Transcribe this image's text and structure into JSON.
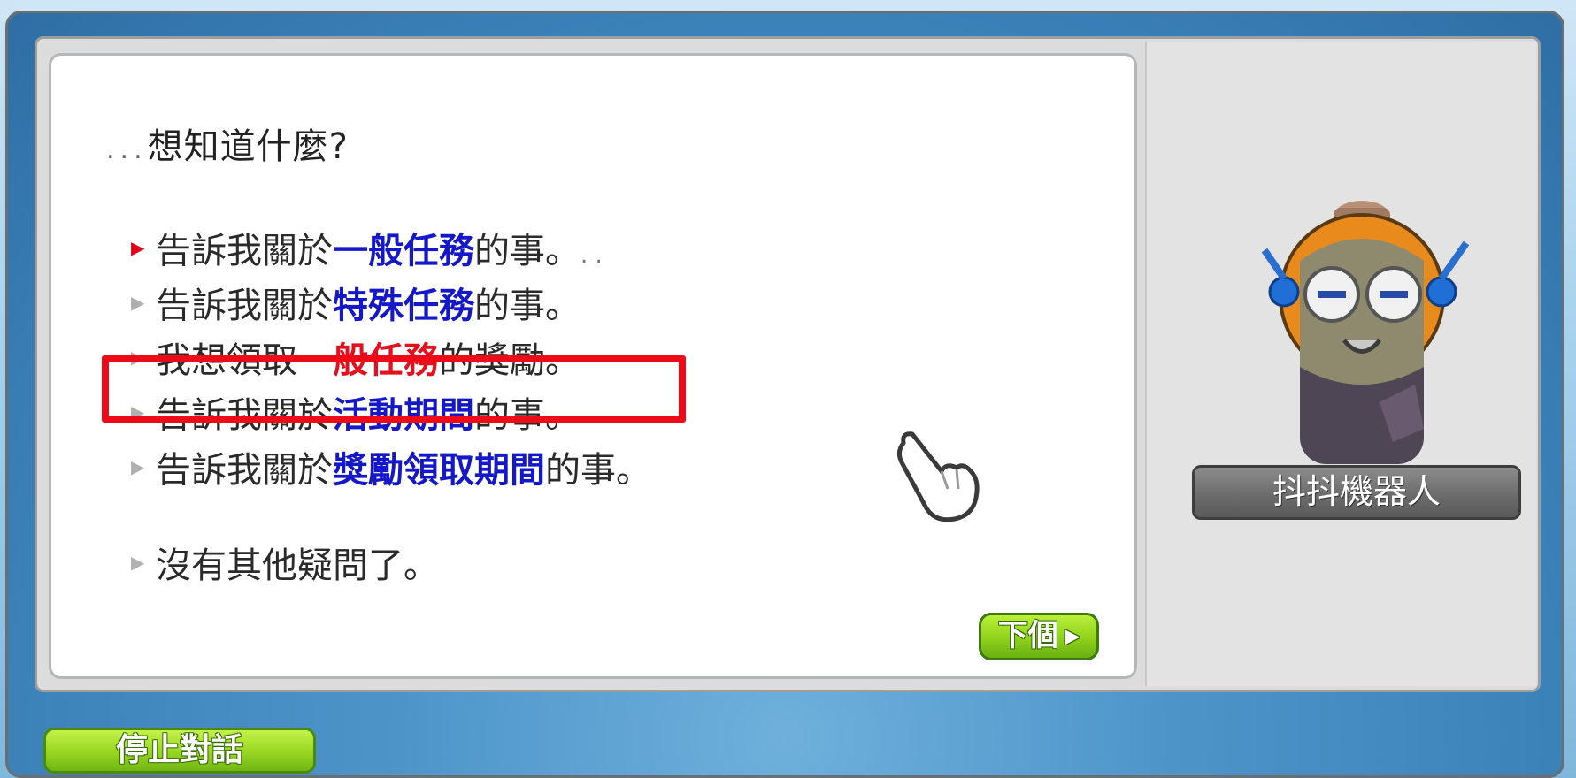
{
  "dialog": {
    "prompt_dots": "...",
    "prompt": "想知道什麼?",
    "options": [
      {
        "prefix": "告訴我關於",
        "keyword": "一般任務",
        "suffix": "的事。",
        "trail": ". .",
        "active": true
      },
      {
        "prefix": "告訴我關於",
        "keyword": "特殊任務",
        "suffix": "的事。",
        "active": false
      },
      {
        "prefix": "我想領取",
        "keyword": "一般任務",
        "suffix": "的獎勵。",
        "active": false,
        "highlighted": true
      },
      {
        "prefix": "告訴我關於",
        "keyword": "活動期間",
        "suffix": "的事。",
        "active": false
      },
      {
        "prefix": "告訴我關於",
        "keyword": "獎勵領取期間",
        "suffix": "的事。",
        "active": false
      },
      {
        "prefix": "沒有其他疑問了。",
        "keyword": "",
        "suffix": "",
        "active": false
      }
    ],
    "next_label": "下個"
  },
  "npc": {
    "name": "抖抖機器人"
  },
  "footer": {
    "stop_label": "停止對話"
  },
  "colors": {
    "keyword_blue": "#1418c8",
    "keyword_red": "#e5101d",
    "highlight_border": "#ee0b17",
    "button_green": "#8fd11b"
  }
}
